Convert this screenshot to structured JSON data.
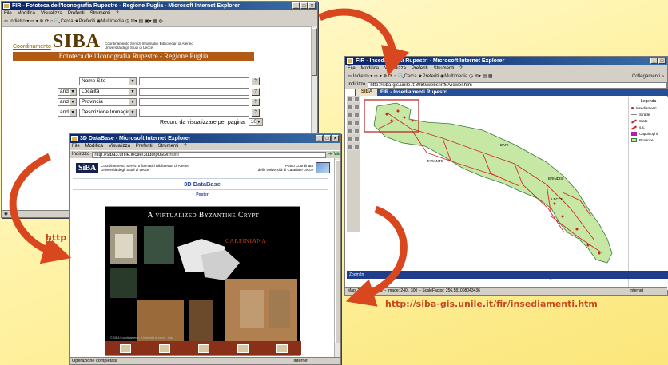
{
  "colors": {
    "arrow": "#d8471e",
    "banner": "#b05a14",
    "titlebar": "#0a246a",
    "map_land": "#c6e8a4",
    "road": "#c62222"
  },
  "window1": {
    "title": "FIR - Fototeca dell'Iconografia Rupestre - Regione Puglia - Microsoft Internet Explorer",
    "menu": [
      "File",
      "Modifica",
      "Visualizza",
      "Preferiti",
      "Strumenti",
      "?"
    ],
    "toolbar": "⇦ Indietro  ▾  ⇨  ▾  ⊗  ⟳  ⌂   🔍Cerca   ★Preferiti   ◉Multimedia   ◷   ✉▾   ▤  ▣▾  ▦   ◍",
    "logo_small": "Coordinamento",
    "logo_big": "SIBA",
    "logo_sub1": "Coordinamento Servizi Informatici Bibliotecari di Ateneo",
    "logo_sub2": "Università degli Studi di Lecce",
    "banner": "Fototeca dell'Iconografia Rupestre - Regione Puglia",
    "rows": [
      {
        "op": "",
        "field": "Nome Sito"
      },
      {
        "op": "and",
        "field": "Località"
      },
      {
        "op": "and",
        "field": "Provincia"
      },
      {
        "op": "and",
        "field": "Descrizione Immagine"
      }
    ],
    "records_label": "Record da visualizzare per pagina:",
    "records_value": "10",
    "partial_label": "http"
  },
  "window2": {
    "title": "FIR - Insediamenti Rupestri - Microsoft Internet Explorer",
    "menu": [
      "File",
      "Modifica",
      "Visualizza",
      "Preferiti",
      "Strumenti",
      "?"
    ],
    "toolbar": "⇦ Indietro ▾ ⇨ ▾ ⊗ ⟳ ⌂  🔍Cerca  ★Preferiti  ◉Multimedia  ◷  ✉▾  ▤  ▦",
    "address_label": "Indirizzo",
    "address": "http://siba-gis.unile.it:8080/websfir/fir/viewer.htm",
    "links": "Collegamenti »",
    "app_logo": "SIBA",
    "app_title": "FIR - Insediamenti Rupestri",
    "legend_title": "Legenda",
    "legend": [
      {
        "label": "Insediamenti",
        "color": "#d02020"
      },
      {
        "label": "Strade",
        "color": "#888888"
      },
      {
        "label": "Stato",
        "color": "#c62222"
      },
      {
        "label": "s.s.",
        "color": "#c62222"
      },
      {
        "label": "Capoluoghi",
        "color": "#b020b0"
      },
      {
        "label": "Province",
        "color": "#c6e8a4"
      }
    ],
    "cities": [
      "BARI",
      "TARANTO",
      "BRINDISI",
      "LECCE"
    ],
    "status_zoom": "Zoom In",
    "status": "Map: 2687S,3 ... 59 -- Image: 240 , 300 -- ScaleFactor: 256.581008043436",
    "status_zone": "Internet"
  },
  "window3": {
    "title": "3D DataBase - Microsoft Internet Explorer",
    "menu": [
      "File",
      "Modifica",
      "Visualizza",
      "Preferiti",
      "Strumenti",
      "?"
    ],
    "address_label": "Indirizzo",
    "address": "http://siba3.unile.it/ctle/3ddb/poster.html",
    "go": "Vai",
    "logo": "SiBA",
    "left_text1": "Coordinamento Servizi Informatici Bibliotecari di Ateneo",
    "left_text2": "Università degli Studi di Lecce",
    "right_text1": "Piano Coordinato",
    "right_text2": "delle Università di Catania e Lecce",
    "heading": "3D DataBase",
    "subheading": "Poster",
    "poster_title": "A virtualized Byzantine Crypt",
    "poster_name": "CARPINIANA",
    "poster_copy": "© SIBA Coordinamento - Università di Lecce - Italy",
    "status": "Operazione completata",
    "status_zone": "Internet"
  },
  "url_label": "http://siba-gis.unile.it/fir/insediamenti.htm"
}
